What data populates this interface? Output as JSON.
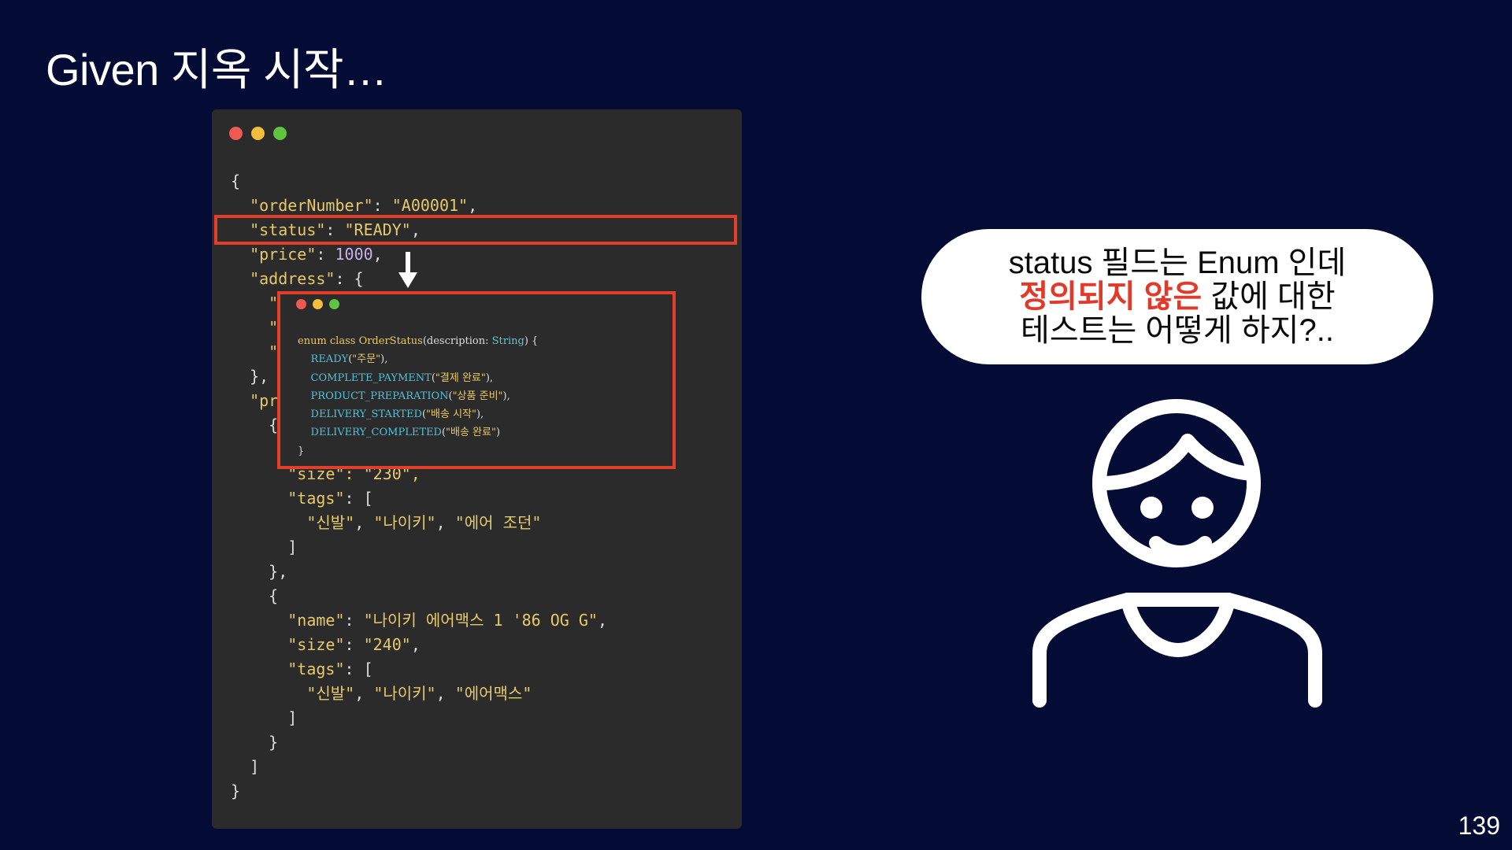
{
  "title": "Given 지옥 시작…",
  "page_number": "139",
  "colors": {
    "background": "#040c35",
    "highlight_border": "#e23e2a",
    "emphasis_red": "#e03a2a"
  },
  "icons": [
    "window-close-dot",
    "window-minimize-dot",
    "window-maximize-dot",
    "down-arrow-icon",
    "person-icon"
  ],
  "json_code": {
    "lines": [
      [
        [
          "{",
          "p"
        ]
      ],
      [
        [
          "  ",
          "p"
        ],
        [
          "\"orderNumber\"",
          "k"
        ],
        [
          ": ",
          "p"
        ],
        [
          "\"A00001\"",
          "s"
        ],
        [
          ",",
          "p"
        ]
      ],
      [
        [
          "  ",
          "p"
        ],
        [
          "\"status\"",
          "k"
        ],
        [
          ": ",
          "p"
        ],
        [
          "\"READY\"",
          "s"
        ],
        [
          ",",
          "p"
        ]
      ],
      [
        [
          "  ",
          "p"
        ],
        [
          "\"price\"",
          "k"
        ],
        [
          ": ",
          "p"
        ],
        [
          "1000",
          "n"
        ],
        [
          ",",
          "p"
        ]
      ],
      [
        [
          "  ",
          "p"
        ],
        [
          "\"address\"",
          "k"
        ],
        [
          ": {",
          "p"
        ]
      ],
      [
        [
          "    ",
          "p"
        ],
        [
          "\"",
          "k"
        ]
      ],
      [
        [
          "    ",
          "p"
        ],
        [
          "\"",
          "k"
        ]
      ],
      [
        [
          "    ",
          "p"
        ],
        [
          "\"",
          "k"
        ]
      ],
      [
        [
          "  },",
          "p"
        ]
      ],
      [
        [
          "  ",
          "p"
        ],
        [
          "\"pr",
          "k"
        ]
      ],
      [
        [
          "    {",
          "p"
        ]
      ],
      [
        [
          "",
          "p"
        ]
      ],
      [
        [
          "      ",
          "p"
        ],
        [
          "\"size\": \"230\",",
          "k"
        ]
      ],
      [
        [
          "      ",
          "p"
        ],
        [
          "\"tags\"",
          "k"
        ],
        [
          ": [",
          "p"
        ]
      ],
      [
        [
          "        ",
          "p"
        ],
        [
          "\"신발\"",
          "s"
        ],
        [
          ", ",
          "p"
        ],
        [
          "\"나이키\"",
          "s"
        ],
        [
          ", ",
          "p"
        ],
        [
          "\"에어 조던\"",
          "s"
        ]
      ],
      [
        [
          "      ]",
          "p"
        ]
      ],
      [
        [
          "    },",
          "p"
        ]
      ],
      [
        [
          "    {",
          "p"
        ]
      ],
      [
        [
          "      ",
          "p"
        ],
        [
          "\"name\"",
          "k"
        ],
        [
          ": ",
          "p"
        ],
        [
          "\"나이키 에어맥스 1 '86 OG G\"",
          "s"
        ],
        [
          ",",
          "p"
        ]
      ],
      [
        [
          "      ",
          "p"
        ],
        [
          "\"size\"",
          "k"
        ],
        [
          ": ",
          "p"
        ],
        [
          "\"240\"",
          "s"
        ],
        [
          ",",
          "p"
        ]
      ],
      [
        [
          "      ",
          "p"
        ],
        [
          "\"tags\"",
          "k"
        ],
        [
          ": [",
          "p"
        ]
      ],
      [
        [
          "        ",
          "p"
        ],
        [
          "\"신발\"",
          "s"
        ],
        [
          ", ",
          "p"
        ],
        [
          "\"나이키\"",
          "s"
        ],
        [
          ", ",
          "p"
        ],
        [
          "\"에어맥스\"",
          "s"
        ]
      ],
      [
        [
          "      ]",
          "p"
        ]
      ],
      [
        [
          "    }",
          "p"
        ]
      ],
      [
        [
          "  ]",
          "p"
        ]
      ],
      [
        [
          "}",
          "p"
        ]
      ]
    ]
  },
  "enum_code": {
    "lines": [
      [
        [
          "enum class ",
          "kw"
        ],
        [
          "OrderStatus",
          "cls"
        ],
        [
          "(description: ",
          "p"
        ],
        [
          "String",
          "tp"
        ],
        [
          ") {",
          "p"
        ]
      ],
      [
        [
          "    ",
          "p"
        ],
        [
          "READY",
          "en"
        ],
        [
          "(",
          "p"
        ],
        [
          "\"주문\"",
          "str"
        ],
        [
          "),",
          "p"
        ]
      ],
      [
        [
          "    ",
          "p"
        ],
        [
          "COMPLETE_PAYMENT",
          "en"
        ],
        [
          "(",
          "p"
        ],
        [
          "\"결제 완료\"",
          "str"
        ],
        [
          "),",
          "p"
        ]
      ],
      [
        [
          "    ",
          "p"
        ],
        [
          "PRODUCT_PREPARATION",
          "en"
        ],
        [
          "(",
          "p"
        ],
        [
          "\"상품 준비\"",
          "str"
        ],
        [
          "),",
          "p"
        ]
      ],
      [
        [
          "    ",
          "p"
        ],
        [
          "DELIVERY_STARTED",
          "en"
        ],
        [
          "(",
          "p"
        ],
        [
          "\"배송 시작\"",
          "str"
        ],
        [
          "),",
          "p"
        ]
      ],
      [
        [
          "    ",
          "p"
        ],
        [
          "DELIVERY_COMPLETED",
          "en"
        ],
        [
          "(",
          "p"
        ],
        [
          "\"배송 완료\"",
          "str"
        ],
        [
          ")",
          "p"
        ]
      ],
      [
        [
          "}",
          "p"
        ]
      ]
    ]
  },
  "bubble": {
    "line1": "status 필드는 Enum 인데",
    "line2_red": "정의되지 않은",
    "line2_rest": " 값에 대한",
    "line3": "테스트는 어떻게 하지?.."
  }
}
